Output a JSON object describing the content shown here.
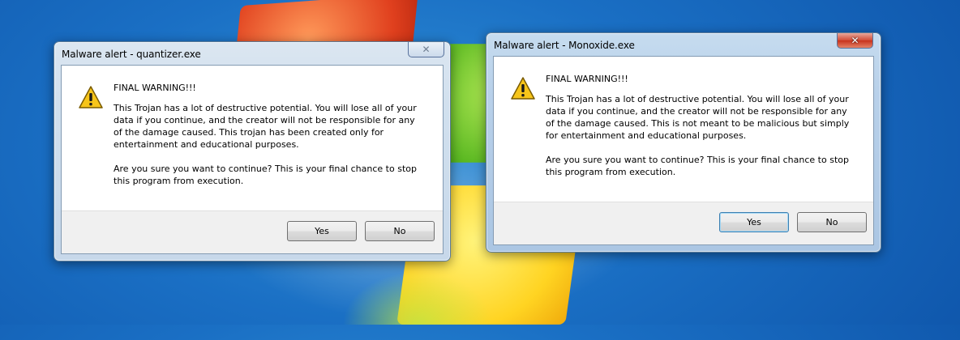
{
  "desktop": {
    "wallpaper": "Windows 7 default blue"
  },
  "dialogs": [
    {
      "title": "Malware alert - quantizer.exe",
      "heading": "FINAL WARNING!!!",
      "paragraph1": "This Trojan has a lot of destructive potential. You will lose all of your data if you continue, and the creator will not be responsible for any of the damage caused. This trojan has been created only for entertainment and educational purposes.",
      "paragraph2": "Are you sure you want to continue? This is your final chance to stop this program from execution.",
      "yes_label": "Yes",
      "no_label": "No",
      "close_glyph": "✕",
      "state": "inactive"
    },
    {
      "title": "Malware alert - Monoxide.exe",
      "heading": "FINAL WARNING!!!",
      "paragraph1": "This Trojan has a lot of destructive potential. You will lose all of your data if you continue, and the creator will not be responsible for any of the damage caused. This is not meant to be malicious but simply for entertainment and educational purposes.",
      "paragraph2": "Are you sure you want to continue? This is your final chance to stop this program from execution.",
      "yes_label": "Yes",
      "no_label": "No",
      "close_glyph": "✕",
      "state": "active"
    }
  ],
  "icons": {
    "warning": "warning-triangle-icon",
    "close": "close-icon"
  },
  "colors": {
    "close_active": "#c7321c",
    "title_bar": "#b9d1ea",
    "footer": "#f0f0f0"
  }
}
